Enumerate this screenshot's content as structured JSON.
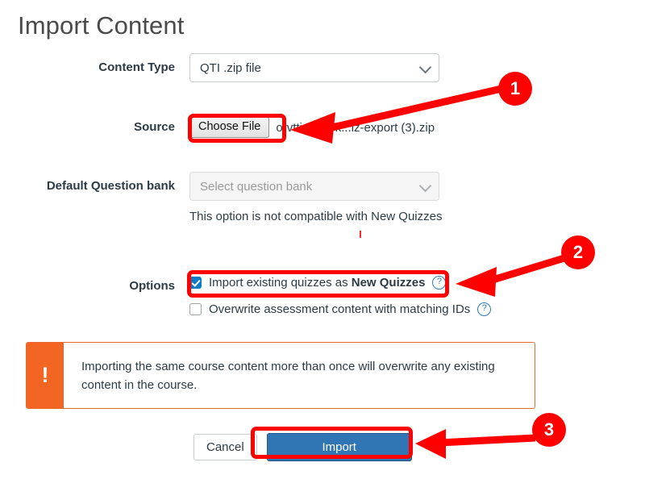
{
  "page": {
    "title": "Import Content"
  },
  "form": {
    "content_type": {
      "label": "Content Type",
      "value": "QTI .zip file"
    },
    "source": {
      "label": "Source",
      "choose_file_label": "Choose File",
      "file_name": "orvttisaastrk...iz-export (3).zip"
    },
    "question_bank": {
      "label": "Default Question bank",
      "placeholder": "Select question bank",
      "helper_text": "This option is not compatible with New Quizzes"
    },
    "options": {
      "label": "Options",
      "items": [
        {
          "text_before": "Import existing quizzes as ",
          "text_bold": "New Quizzes",
          "checked": true,
          "help": "?"
        },
        {
          "text_before": "Overwrite assessment content with matching IDs",
          "text_bold": "",
          "checked": false,
          "help": "?"
        }
      ]
    }
  },
  "warning": {
    "icon": "exclamation-mark",
    "icon_glyph": "!",
    "message": "Importing the same course content more than once will overwrite any existing content in the course."
  },
  "footer": {
    "cancel_label": "Cancel",
    "import_label": "Import"
  },
  "annotations": {
    "steps": [
      {
        "number": "1"
      },
      {
        "number": "2"
      },
      {
        "number": "3"
      }
    ],
    "colors": {
      "highlight": "#FF0000",
      "badge": "#FF0000",
      "warning_orange": "#F26522",
      "primary_button": "#3176B4",
      "checkbox_blue": "#0A7BC4",
      "help_icon_blue": "#2B7ABC"
    }
  }
}
